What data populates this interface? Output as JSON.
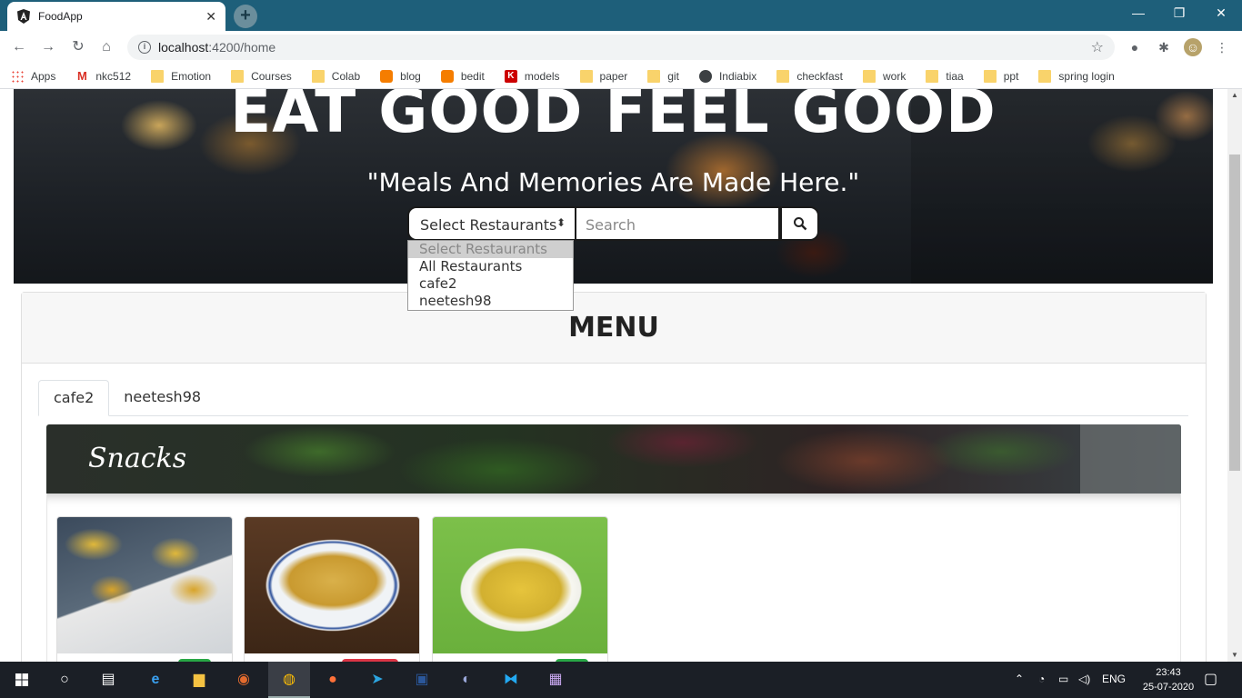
{
  "browser": {
    "tab_title": "FoodApp",
    "tab_close": "✕",
    "new_tab": "+",
    "url_host": "localhost",
    "url_path": ":4200/home",
    "window_controls": [
      "—",
      "❐",
      "✕"
    ],
    "bookmarks": [
      {
        "label": "Apps",
        "icon": "apps"
      },
      {
        "label": "nkc512",
        "icon": "gmail"
      },
      {
        "label": "Emotion",
        "icon": "folder"
      },
      {
        "label": "Courses",
        "icon": "folder"
      },
      {
        "label": "Colab",
        "icon": "folder"
      },
      {
        "label": "blog",
        "icon": "blogger"
      },
      {
        "label": "bedit",
        "icon": "blogger"
      },
      {
        "label": "models",
        "icon": "k"
      },
      {
        "label": "paper",
        "icon": "folder"
      },
      {
        "label": "git",
        "icon": "folder"
      },
      {
        "label": "Indiabix",
        "icon": "globe"
      },
      {
        "label": "checkfast",
        "icon": "folder"
      },
      {
        "label": "work",
        "icon": "folder"
      },
      {
        "label": "tiaa",
        "icon": "folder"
      },
      {
        "label": "ppt",
        "icon": "folder"
      },
      {
        "label": "spring login",
        "icon": "folder"
      }
    ]
  },
  "hero": {
    "title": "EAT GOOD FEEL GOOD",
    "subtitle": "\"Meals And Memories Are Made Here.\"",
    "select_value": "Select Restaurants",
    "search_placeholder": "Search",
    "dropdown_options": [
      "Select Restaurants",
      "All Restaurants",
      "cafe2",
      "neetesh98"
    ]
  },
  "menu": {
    "title": "MENU",
    "tabs": [
      "cafe2",
      "neetesh98"
    ],
    "active_tab": "cafe2",
    "category": "Snacks",
    "items": [
      {
        "image": "sev-puri",
        "badge_color": "#28a745"
      },
      {
        "image": "omelette",
        "badge_color": "#dc3545"
      },
      {
        "image": "poha",
        "badge_color": "#28a745"
      }
    ]
  },
  "taskbar": {
    "language": "ENG",
    "time": "23:43",
    "date": "25-07-2020"
  },
  "colors": {
    "titlebar": "#1e5f7a",
    "taskbar": "#1b1f26",
    "veg_badge": "#28a745",
    "nonveg_badge": "#dc3545"
  }
}
